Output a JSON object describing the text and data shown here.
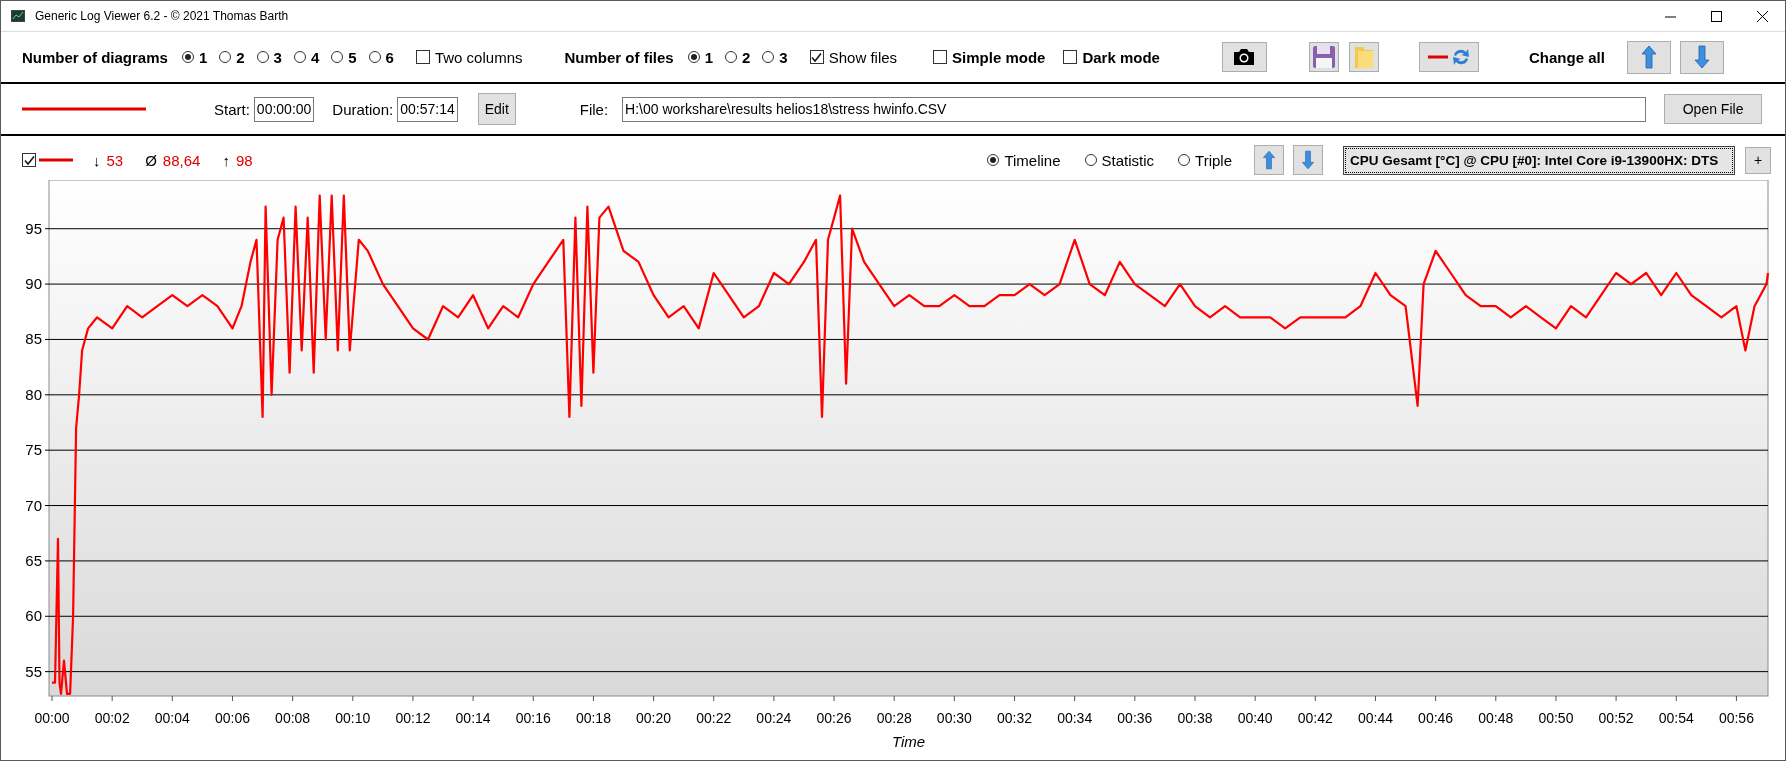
{
  "window": {
    "title": "Generic Log Viewer 6.2 - © 2021 Thomas Barth"
  },
  "toolbar": {
    "diagrams_label": "Number of diagrams",
    "diagram_options": [
      {
        "label": "1",
        "selected": true
      },
      {
        "label": "2",
        "selected": false
      },
      {
        "label": "3",
        "selected": false
      },
      {
        "label": "4",
        "selected": false
      },
      {
        "label": "5",
        "selected": false
      },
      {
        "label": "6",
        "selected": false
      }
    ],
    "two_columns": {
      "label": "Two columns",
      "checked": false
    },
    "files_label": "Number of files",
    "file_options": [
      {
        "label": "1",
        "selected": true
      },
      {
        "label": "2",
        "selected": false
      },
      {
        "label": "3",
        "selected": false
      }
    ],
    "show_files": {
      "label": "Show files",
      "checked": true
    },
    "simple_mode": {
      "label": "Simple mode",
      "checked": false
    },
    "dark_mode": {
      "label": "Dark mode",
      "checked": false
    },
    "change_all_label": "Change all"
  },
  "file_row": {
    "start_label": "Start:",
    "start": "00:00:00",
    "duration_label": "Duration:",
    "duration": "00:57:14",
    "edit_button": "Edit",
    "file_label": "File:",
    "file_path": "H:\\00 workshare\\results helios18\\stress hwinfo.CSV",
    "open_button": "Open File"
  },
  "diagram": {
    "visible": true,
    "min_symbol": "↓",
    "min": "53",
    "avg_symbol": "Ø",
    "avg": "88,64",
    "max_symbol": "↑",
    "max": "98",
    "views": [
      {
        "label": "Timeline",
        "selected": true
      },
      {
        "label": "Statistic",
        "selected": false
      },
      {
        "label": "Triple",
        "selected": false
      }
    ],
    "channel": "CPU Gesamt [°C] @ CPU [#0]: Intel Core i9-13900HX: DTS",
    "add_button": "+",
    "chart_data": {
      "type": "line",
      "xlabel": "Time",
      "xlim": [
        -0.1,
        57.05
      ],
      "ylim": [
        52.8,
        99.4
      ],
      "grid": true,
      "x": [
        0,
        0.1,
        0.2,
        0.25,
        0.3,
        0.4,
        0.5,
        0.6,
        0.7,
        0.8,
        0.9,
        1.0,
        1.2,
        1.5,
        2,
        2.5,
        3,
        3.5,
        4,
        4.5,
        5,
        5.5,
        6,
        6.3,
        6.6,
        6.8,
        7.0,
        7.1,
        7.3,
        7.5,
        7.7,
        7.9,
        8.1,
        8.3,
        8.5,
        8.7,
        8.9,
        9.1,
        9.3,
        9.5,
        9.7,
        9.9,
        10.2,
        10.5,
        11,
        11.5,
        12,
        12.5,
        13,
        13.5,
        14,
        14.5,
        15,
        15.5,
        16,
        16.5,
        17,
        17.2,
        17.4,
        17.6,
        17.8,
        18,
        18.2,
        18.5,
        19,
        19.5,
        20,
        20.5,
        21,
        21.5,
        22,
        22.5,
        23,
        23.5,
        24,
        24.5,
        25,
        25.4,
        25.6,
        25.8,
        26,
        26.2,
        26.4,
        26.6,
        27,
        27.5,
        28,
        28.5,
        29,
        29.5,
        30,
        30.5,
        31,
        31.5,
        32,
        32.5,
        33,
        33.5,
        34,
        34.5,
        35,
        35.5,
        36,
        36.5,
        37,
        37.5,
        38,
        38.5,
        39,
        39.5,
        40,
        40.5,
        41,
        41.5,
        42,
        42.5,
        43,
        43.5,
        44,
        44.5,
        45,
        45.4,
        45.6,
        46,
        46.5,
        47,
        47.5,
        48,
        48.5,
        49,
        49.5,
        50,
        50.5,
        51,
        51.5,
        52,
        52.5,
        53,
        53.5,
        54,
        54.5,
        55,
        55.5,
        56,
        56.3,
        56.6,
        57,
        57.05
      ],
      "series": [
        {
          "color": "#ff0000",
          "values": [
            54,
            54,
            67,
            54,
            53,
            56,
            53,
            53,
            60,
            77,
            80,
            84,
            86,
            87,
            86,
            88,
            87,
            88,
            89,
            88,
            89,
            88,
            86,
            88,
            92,
            94,
            78,
            97,
            80,
            94,
            96,
            82,
            97,
            84,
            96,
            82,
            98,
            85,
            98,
            84,
            98,
            84,
            94,
            93,
            90,
            88,
            86,
            85,
            88,
            87,
            89,
            86,
            88,
            87,
            90,
            92,
            94,
            78,
            96,
            79,
            97,
            82,
            96,
            97,
            93,
            92,
            89,
            87,
            88,
            86,
            91,
            89,
            87,
            88,
            91,
            90,
            92,
            94,
            78,
            94,
            96,
            98,
            81,
            95,
            92,
            90,
            88,
            89,
            88,
            88,
            89,
            88,
            88,
            89,
            89,
            90,
            89,
            90,
            94,
            90,
            89,
            92,
            90,
            89,
            88,
            90,
            88,
            87,
            88,
            87,
            87,
            87,
            86,
            87,
            87,
            87,
            87,
            88,
            91,
            89,
            88,
            79,
            90,
            93,
            91,
            89,
            88,
            88,
            87,
            88,
            87,
            86,
            88,
            87,
            89,
            91,
            90,
            91,
            89,
            91,
            89,
            88,
            87,
            88,
            84,
            88,
            90,
            91
          ]
        }
      ],
      "yticks": [
        55,
        60,
        65,
        70,
        75,
        80,
        85,
        90,
        95
      ],
      "xticks": [
        {
          "value": 0,
          "label": "00:00"
        },
        {
          "value": 2,
          "label": "00:02"
        },
        {
          "value": 4,
          "label": "00:04"
        },
        {
          "value": 6,
          "label": "00:06"
        },
        {
          "value": 8,
          "label": "00:08"
        },
        {
          "value": 10,
          "label": "00:10"
        },
        {
          "value": 12,
          "label": "00:12"
        },
        {
          "value": 14,
          "label": "00:14"
        },
        {
          "value": 16,
          "label": "00:16"
        },
        {
          "value": 18,
          "label": "00:18"
        },
        {
          "value": 20,
          "label": "00:20"
        },
        {
          "value": 22,
          "label": "00:22"
        },
        {
          "value": 24,
          "label": "00:24"
        },
        {
          "value": 26,
          "label": "00:26"
        },
        {
          "value": 28,
          "label": "00:28"
        },
        {
          "value": 30,
          "label": "00:30"
        },
        {
          "value": 32,
          "label": "00:32"
        },
        {
          "value": 34,
          "label": "00:34"
        },
        {
          "value": 36,
          "label": "00:36"
        },
        {
          "value": 38,
          "label": "00:38"
        },
        {
          "value": 40,
          "label": "00:40"
        },
        {
          "value": 42,
          "label": "00:42"
        },
        {
          "value": 44,
          "label": "00:44"
        },
        {
          "value": 46,
          "label": "00:46"
        },
        {
          "value": 48,
          "label": "00:48"
        },
        {
          "value": 50,
          "label": "00:50"
        },
        {
          "value": 52,
          "label": "00:52"
        },
        {
          "value": 54,
          "label": "00:54"
        },
        {
          "value": 56,
          "label": "00:56"
        }
      ]
    }
  }
}
